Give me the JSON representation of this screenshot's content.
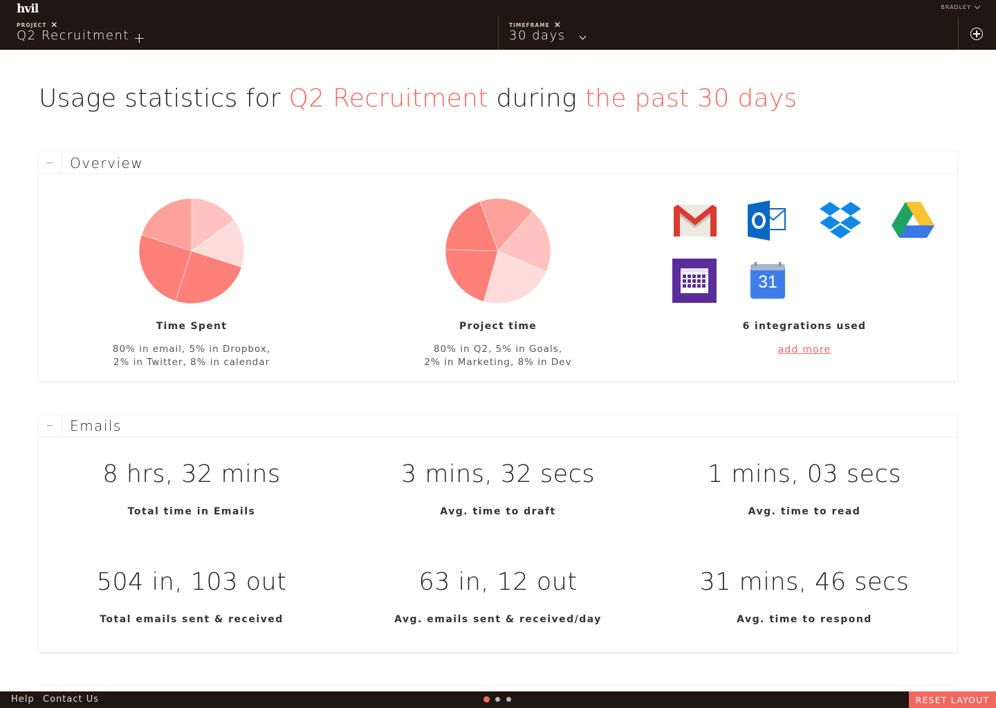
{
  "app": {
    "logo": "hvil",
    "user": "BRADLEY"
  },
  "filters": {
    "project_label": "PROJECT",
    "project_value": "Q2 Recruitment",
    "timeframe_label": "TIMEFRAME",
    "timeframe_value": "30 days"
  },
  "heading": {
    "part1": "Usage statistics for ",
    "project": "Q2 Recruitment",
    "part2": " during ",
    "timeframe": "the past 30 days"
  },
  "overview": {
    "title": "Overview",
    "time_spent": {
      "title": "Time Spent",
      "desc_line1": "80% in email, 5% in Dropbox,",
      "desc_line2": "2% in Twitter, 8% in calendar"
    },
    "project_time": {
      "title": "Project time",
      "desc_line1": "80% in Q2, 5% in Goals,",
      "desc_line2": "2% in Marketing, 8% in Dev"
    },
    "integrations": {
      "title": "6 integrations used",
      "link": "add more",
      "icons": [
        "gmail-icon",
        "outlook-icon",
        "dropbox-icon",
        "google-drive-icon",
        "calendar-icon",
        "google-calendar-icon"
      ],
      "calendar_day": "31"
    }
  },
  "chart_data": [
    {
      "type": "pie",
      "title": "Time Spent",
      "slices": [
        {
          "value": 15,
          "color": "#ffc2be"
        },
        {
          "value": 15,
          "color": "#ffdcda"
        },
        {
          "value": 25,
          "color": "#ff8079"
        },
        {
          "value": 25,
          "color": "#ff8079"
        },
        {
          "value": 20,
          "color": "#ffa19b"
        }
      ]
    },
    {
      "type": "pie",
      "title": "Project time",
      "slices": [
        {
          "value": 17,
          "color": "#ffa19b"
        },
        {
          "value": 20,
          "color": "#ffc2be"
        },
        {
          "value": 23,
          "color": "#ffdcda"
        },
        {
          "value": 21,
          "color": "#ff8079"
        },
        {
          "value": 19,
          "color": "#ff8079"
        }
      ]
    }
  ],
  "emails": {
    "title": "Emails",
    "stats": [
      {
        "value": "8 hrs, 32 mins",
        "label": "Total time in Emails"
      },
      {
        "value": "3 mins, 32 secs",
        "label": "Avg. time to draft"
      },
      {
        "value": "1 mins, 03 secs",
        "label": "Avg. time to read"
      },
      {
        "value": "504 in, 103 out",
        "label": "Total emails sent & received"
      },
      {
        "value": "63 in, 12 out",
        "label": "Avg. emails sent & received/day"
      },
      {
        "value": "31 mins, 46 secs",
        "label": "Avg. time to respond"
      }
    ]
  },
  "footer": {
    "help": "Help",
    "contact": "Contact Us",
    "reset": "RESET LAYOUT",
    "pages": 3,
    "active_page": 1
  },
  "colors": {
    "accent": "#f2685f",
    "topbar": "#1e1810"
  }
}
